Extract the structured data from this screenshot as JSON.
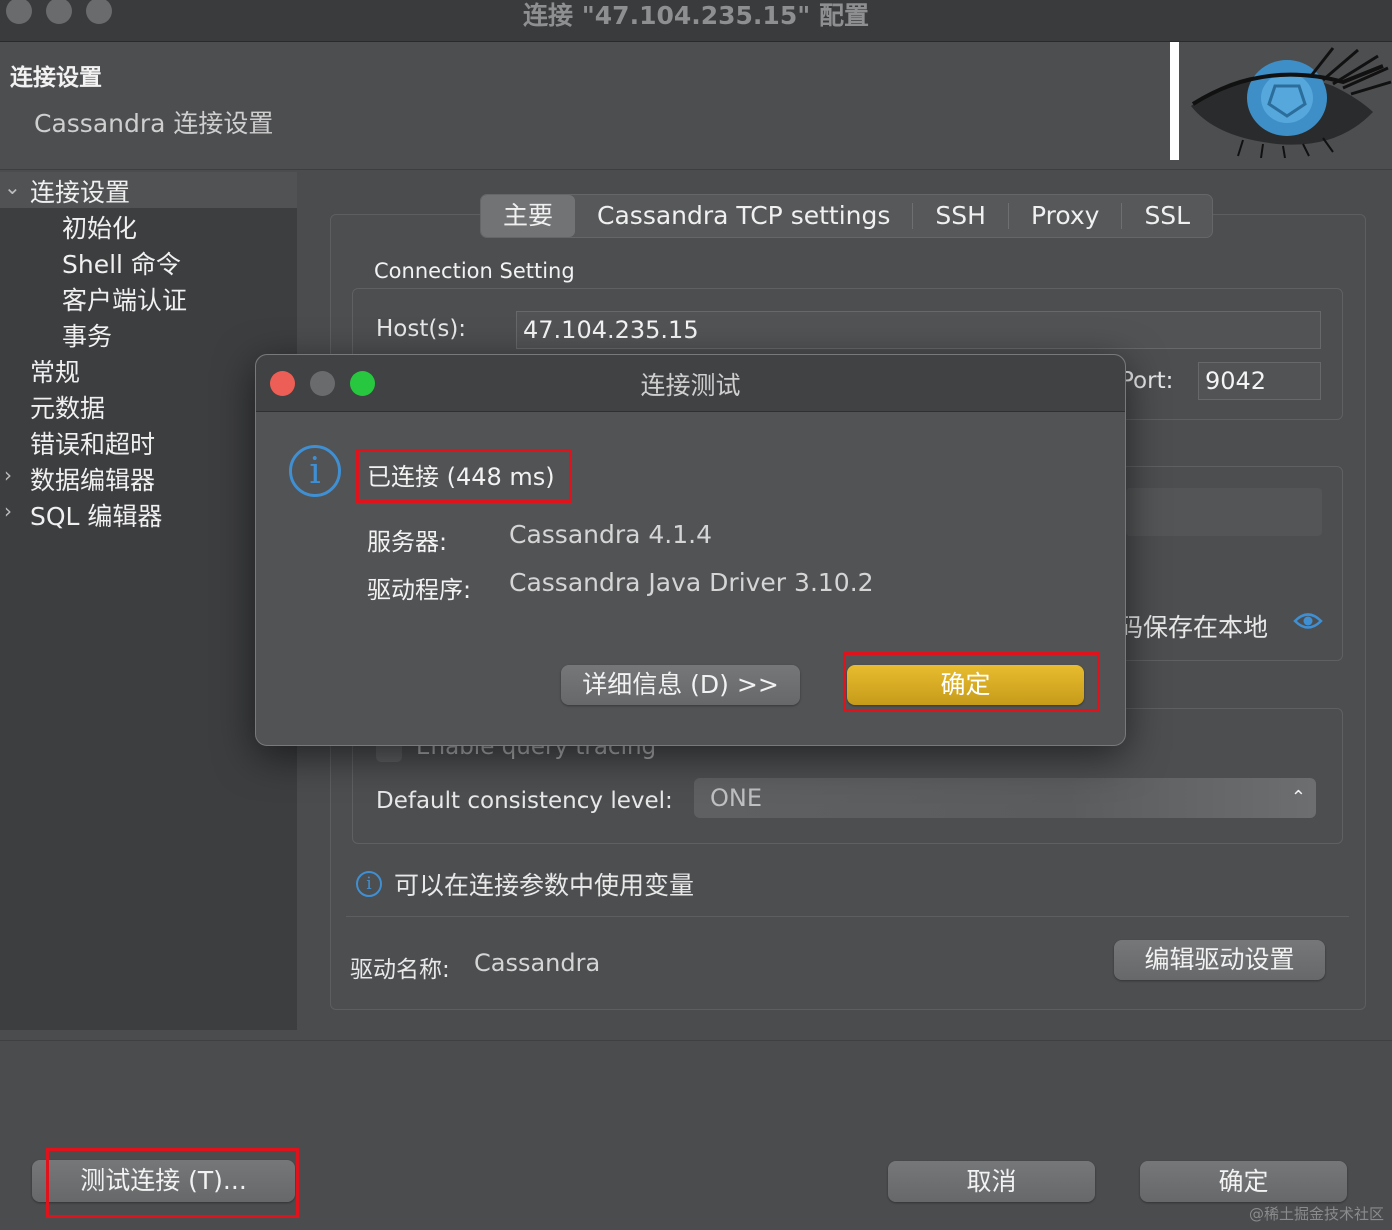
{
  "window": {
    "title": "连接 \"47.104.235.15\" 配置"
  },
  "header": {
    "title": "连接设置",
    "subtitle": "Cassandra 连接设置"
  },
  "sidebar": {
    "items": [
      {
        "label": "连接设置",
        "expanded": true
      },
      {
        "label": "初始化"
      },
      {
        "label": "Shell 命令"
      },
      {
        "label": "客户端认证"
      },
      {
        "label": "事务"
      },
      {
        "label": "常规"
      },
      {
        "label": "元数据"
      },
      {
        "label": "错误和超时"
      },
      {
        "label": "数据编辑器",
        "expanded": false
      },
      {
        "label": "SQL 编辑器",
        "expanded": false
      }
    ]
  },
  "tabs": [
    {
      "label": "主要",
      "active": true
    },
    {
      "label": "Cassandra TCP settings"
    },
    {
      "label": "SSH"
    },
    {
      "label": "Proxy"
    },
    {
      "label": "SSL"
    }
  ],
  "connection": {
    "group_label": "Connection Setting",
    "host_label": "Host(s):",
    "host_value": "47.104.235.15",
    "port_label": "Port:",
    "port_value": "9042"
  },
  "auth": {
    "save_local_text": "码保存在本地"
  },
  "options": {
    "query_tracing_label": "Enable query tracing",
    "consistency_label": "Default consistency level:",
    "consistency_value": "ONE"
  },
  "variables_note": "可以在连接参数中使用变量",
  "driver": {
    "name_label": "驱动名称:",
    "name_value": "Cassandra",
    "edit_button": "编辑驱动设置"
  },
  "footer": {
    "test_button": "测试连接 (T)...",
    "cancel_button": "取消",
    "ok_button": "确定"
  },
  "dialog": {
    "title": "连接测试",
    "status": "已连接 (448 ms)",
    "server_label": "服务器:",
    "server_value": "Cassandra 4.1.4",
    "driver_label": "驱动程序:",
    "driver_value": "Cassandra Java Driver 3.10.2",
    "details_button": "详细信息 (D) >>",
    "ok_button": "确定"
  },
  "watermark": "@稀土掘金技术社区",
  "colors": {
    "accent": "#d4a623",
    "highlight_border": "#e0131d",
    "info_blue": "#3f8fd2",
    "close": "#ed5f56",
    "minimize": "#6a6b6d",
    "zoom": "#27c840"
  }
}
